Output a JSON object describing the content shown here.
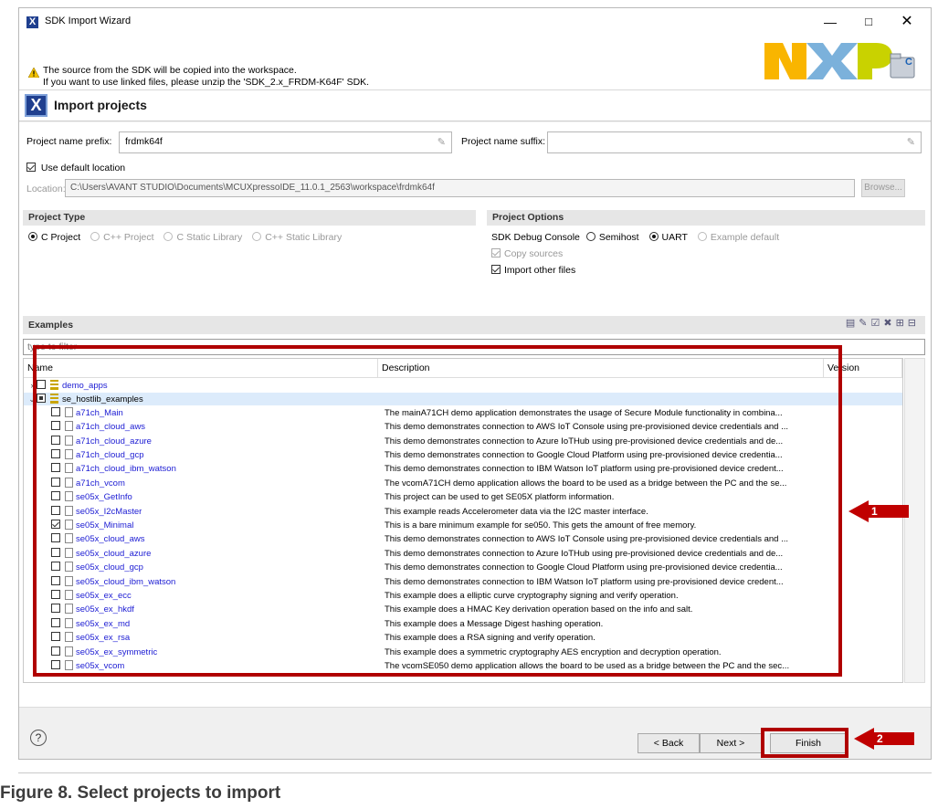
{
  "window": {
    "title": "SDK Import Wizard",
    "controls": {
      "minimize": "—",
      "maximize": "□",
      "close": "✕"
    }
  },
  "banner": {
    "line1": "The source from the SDK will be copied into the workspace.",
    "line2": "If you want to use linked files, please unzip the 'SDK_2.x_FRDM-K64F' SDK.",
    "logo_text": "NXP"
  },
  "header": {
    "title": "Import projects",
    "icon": "X"
  },
  "project": {
    "prefix_label": "Project name prefix:",
    "prefix_value": "frdmk64f",
    "suffix_label": "Project name suffix:",
    "suffix_value": "",
    "use_default_location_label": "Use default location",
    "use_default_location": true,
    "location_label": "Location:",
    "location_value": "C:\\Users\\AVANT STUDIO\\Documents\\MCUXpressoIDE_11.0.1_2563\\workspace\\frdmk64f",
    "browse_label": "Browse..."
  },
  "project_type": {
    "title": "Project Type",
    "options": [
      {
        "label": "C Project",
        "selected": true,
        "enabled": true
      },
      {
        "label": "C++ Project",
        "selected": false,
        "enabled": false
      },
      {
        "label": "C Static Library",
        "selected": false,
        "enabled": false
      },
      {
        "label": "C++ Static Library",
        "selected": false,
        "enabled": false
      }
    ]
  },
  "project_options": {
    "title": "Project Options",
    "debug_console_label": "SDK Debug Console",
    "debug_console_options": [
      {
        "label": "Semihost",
        "selected": false,
        "enabled": true
      },
      {
        "label": "UART",
        "selected": true,
        "enabled": true
      },
      {
        "label": "Example default",
        "selected": false,
        "enabled": false
      }
    ],
    "copy_sources_label": "Copy sources",
    "import_other_files_label": "Import other files"
  },
  "examples": {
    "title": "Examples",
    "filter_placeholder": "type to filter",
    "columns": {
      "name": "Name",
      "description": "Description",
      "version": "Version"
    },
    "groups": [
      {
        "name": "demo_apps",
        "expanded": false,
        "state": "unchecked"
      },
      {
        "name": "se_hostlib_examples",
        "expanded": true,
        "state": "partial"
      }
    ],
    "items": [
      {
        "name": "a71ch_Main",
        "checked": false,
        "description": "The mainA71CH demo application demonstrates the usage of Secure Module functionality in combina..."
      },
      {
        "name": "a71ch_cloud_aws",
        "checked": false,
        "description": "This demo demonstrates connection to AWS IoT Console using pre-provisioned device credentials and ..."
      },
      {
        "name": "a71ch_cloud_azure",
        "checked": false,
        "description": "This demo demonstrates connection to Azure IoTHub using pre-provisioned device credentials and de..."
      },
      {
        "name": "a71ch_cloud_gcp",
        "checked": false,
        "description": "This demo demonstrates connection to Google Cloud Platform using pre-provisioned device credentia..."
      },
      {
        "name": "a71ch_cloud_ibm_watson",
        "checked": false,
        "description": "This demo demonstrates connection to IBM Watson IoT platform using pre-provisioned device credent..."
      },
      {
        "name": "a71ch_vcom",
        "checked": false,
        "description": "The vcomA71CH demo application allows the board to be used as a bridge between the PC and the se..."
      },
      {
        "name": "se05x_GetInfo",
        "checked": false,
        "description": "This project can be used to get SE05X platform information."
      },
      {
        "name": "se05x_I2cMaster",
        "checked": false,
        "description": "This example reads Accelerometer data via the I2C master interface."
      },
      {
        "name": "se05x_Minimal",
        "checked": true,
        "description": "This is a bare minimum example for se050. This gets the amount of free memory."
      },
      {
        "name": "se05x_cloud_aws",
        "checked": false,
        "description": "This demo demonstrates connection to AWS IoT Console using pre-provisioned device credentials and ..."
      },
      {
        "name": "se05x_cloud_azure",
        "checked": false,
        "description": "This demo demonstrates connection to Azure IoTHub using pre-provisioned device credentials and de..."
      },
      {
        "name": "se05x_cloud_gcp",
        "checked": false,
        "description": "This demo demonstrates connection to Google Cloud Platform using pre-provisioned device credentia..."
      },
      {
        "name": "se05x_cloud_ibm_watson",
        "checked": false,
        "description": "This demo demonstrates connection to IBM Watson IoT platform using pre-provisioned device credent..."
      },
      {
        "name": "se05x_ex_ecc",
        "checked": false,
        "description": "This example does a elliptic curve cryptography signing and verify operation."
      },
      {
        "name": "se05x_ex_hkdf",
        "checked": false,
        "description": "This example does a HMAC Key derivation operation based on the info and salt."
      },
      {
        "name": "se05x_ex_md",
        "checked": false,
        "description": "This example does a Message Digest hashing operation."
      },
      {
        "name": "se05x_ex_rsa",
        "checked": false,
        "description": "This example does a RSA signing and verify operation."
      },
      {
        "name": "se05x_ex_symmetric",
        "checked": false,
        "description": "This example does a symmetric cryptography AES encryption and decryption operation."
      },
      {
        "name": "se05x_vcom",
        "checked": false,
        "description": "The vcomSE050 demo application allows the board to be used as a bridge between the PC and the sec..."
      }
    ]
  },
  "annotations": {
    "marker1": "1",
    "marker2": "2",
    "accent": "#c00000"
  },
  "footer": {
    "help": "?",
    "back": "< Back",
    "next": "Next >",
    "finish": "Finish"
  },
  "caption": "Figure 8.   Select projects to import"
}
